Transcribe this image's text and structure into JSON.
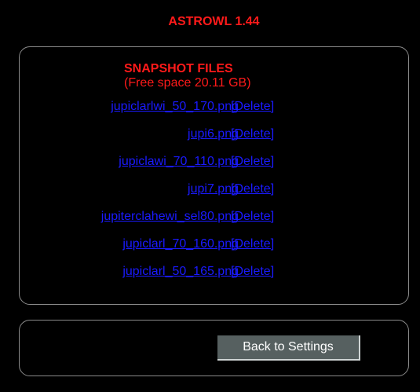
{
  "app": {
    "title": "ASTROWL 1.44"
  },
  "snapshots": {
    "heading": "SNAPSHOT FILES",
    "free_space": "(Free space 20.11 GB)",
    "files": [
      {
        "name": "jupiclarlwi_50_170.png",
        "delete_label": "[Delete]"
      },
      {
        "name": "jupi6.png",
        "delete_label": "[Delete]"
      },
      {
        "name": "jupiclawi_70_110.png",
        "delete_label": "[Delete]"
      },
      {
        "name": "jupi7.png",
        "delete_label": "[Delete]"
      },
      {
        "name": "jupiterclahewi_sel80.png",
        "delete_label": "[Delete]"
      },
      {
        "name": "jupiclarl_70_160.png",
        "delete_label": "[Delete]"
      },
      {
        "name": "jupiclarl_50_165.png",
        "delete_label": "[Delete]"
      }
    ]
  },
  "actions": {
    "back_label": "Back to Settings"
  },
  "colors": {
    "background": "#000000",
    "title_red": "#ff1a1a",
    "link_blue": "#1a1aff",
    "panel_border": "#8a8a8a",
    "button_bg": "#566060"
  }
}
